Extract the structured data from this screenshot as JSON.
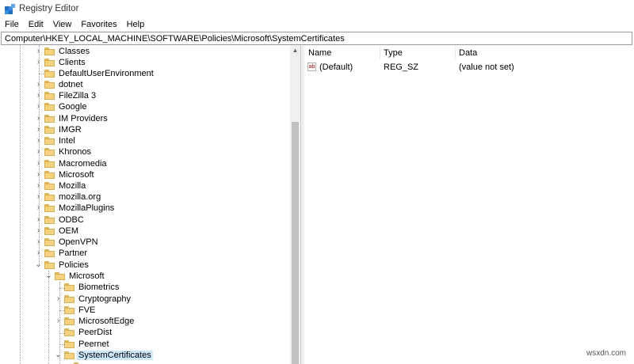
{
  "window": {
    "title": "Registry Editor"
  },
  "menu": [
    "File",
    "Edit",
    "View",
    "Favorites",
    "Help"
  ],
  "address": "Computer\\HKEY_LOCAL_MACHINE\\SOFTWARE\\Policies\\Microsoft\\SystemCertificates",
  "tree": [
    {
      "label": "Classes",
      "expander": "›"
    },
    {
      "label": "Clients",
      "expander": "›"
    },
    {
      "label": "DefaultUserEnvironment",
      "expander": ""
    },
    {
      "label": "dotnet",
      "expander": "›"
    },
    {
      "label": "FileZilla 3",
      "expander": "›"
    },
    {
      "label": "Google",
      "expander": "›"
    },
    {
      "label": "IM Providers",
      "expander": "›"
    },
    {
      "label": "IMGR",
      "expander": "›"
    },
    {
      "label": "Intel",
      "expander": "›"
    },
    {
      "label": "Khronos",
      "expander": "›"
    },
    {
      "label": "Macromedia",
      "expander": "›"
    },
    {
      "label": "Microsoft",
      "expander": "›"
    },
    {
      "label": "Mozilla",
      "expander": "›"
    },
    {
      "label": "mozilla.org",
      "expander": "›"
    },
    {
      "label": "MozillaPlugins",
      "expander": "›"
    },
    {
      "label": "ODBC",
      "expander": "›"
    },
    {
      "label": "OEM",
      "expander": "›"
    },
    {
      "label": "OpenVPN",
      "expander": "›"
    },
    {
      "label": "Partner",
      "expander": "›"
    },
    {
      "label": "Policies",
      "expander": "⌄"
    },
    {
      "label": "Microsoft",
      "expander": "⌄"
    },
    {
      "label": "Biometrics",
      "expander": ""
    },
    {
      "label": "Cryptography",
      "expander": "›"
    },
    {
      "label": "FVE",
      "expander": ""
    },
    {
      "label": "MicrosoftEdge",
      "expander": "›"
    },
    {
      "label": "PeerDist",
      "expander": ""
    },
    {
      "label": "Peernet",
      "expander": ""
    },
    {
      "label": "SystemCertificates",
      "expander": "⌄"
    }
  ],
  "values_header": {
    "name": "Name",
    "type": "Type",
    "data": "Data"
  },
  "values": [
    {
      "name": "(Default)",
      "type": "REG_SZ",
      "data": "(value not set)",
      "icon": "string-value-icon"
    }
  ],
  "watermark": "wsxdn.com"
}
